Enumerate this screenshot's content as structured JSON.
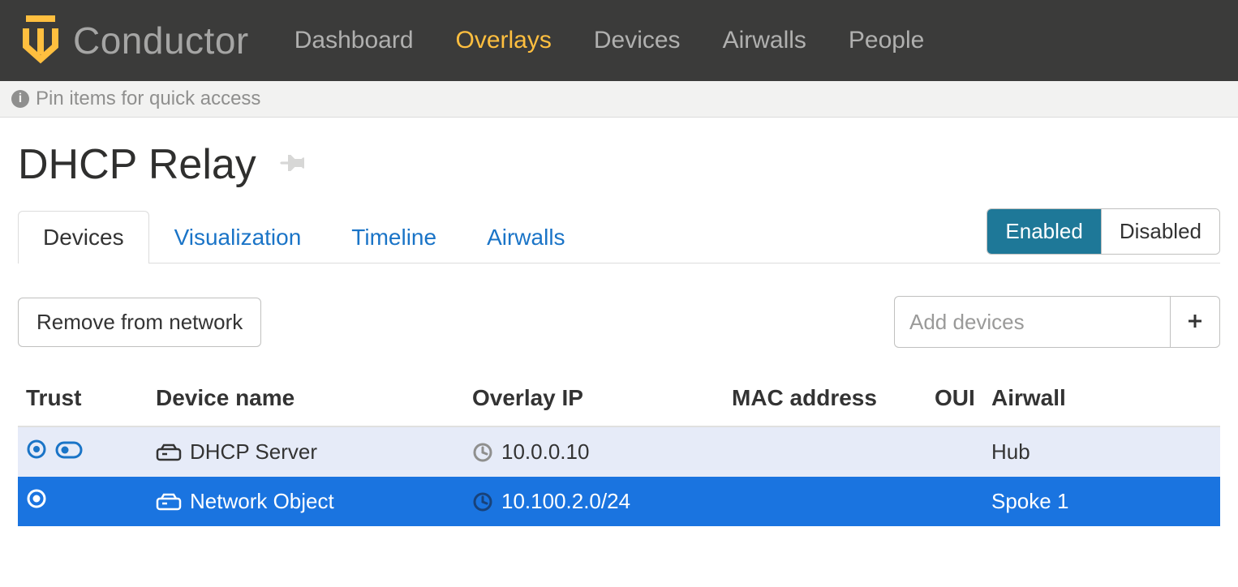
{
  "brand": {
    "name": "Conductor"
  },
  "nav": {
    "items": [
      {
        "label": "Dashboard"
      },
      {
        "label": "Overlays",
        "active": true
      },
      {
        "label": "Devices"
      },
      {
        "label": "Airwalls"
      },
      {
        "label": "People"
      }
    ]
  },
  "pinbar": {
    "text": "Pin items for quick access"
  },
  "page": {
    "title": "DHCP Relay"
  },
  "tabs": {
    "items": [
      {
        "label": "Devices",
        "active": true
      },
      {
        "label": "Visualization"
      },
      {
        "label": "Timeline"
      },
      {
        "label": "Airwalls"
      }
    ]
  },
  "toggle": {
    "enabled": "Enabled",
    "disabled": "Disabled",
    "active": "enabled"
  },
  "tools": {
    "remove_label": "Remove from network",
    "add_placeholder": "Add devices"
  },
  "table": {
    "columns": {
      "trust": "Trust",
      "device_name": "Device name",
      "overlay_ip": "Overlay IP",
      "mac": "MAC address",
      "oui": "OUI",
      "airwall": "Airwall"
    },
    "rows": [
      {
        "device_name": "DHCP Server",
        "overlay_ip": "10.0.0.10",
        "mac": "",
        "oui": "",
        "airwall": "Hub",
        "selected": false,
        "has_pill": true
      },
      {
        "device_name": "Network Object",
        "overlay_ip": "10.100.2.0/24",
        "mac": "",
        "oui": "",
        "airwall": "Spoke 1",
        "selected": true,
        "has_pill": false
      }
    ]
  }
}
